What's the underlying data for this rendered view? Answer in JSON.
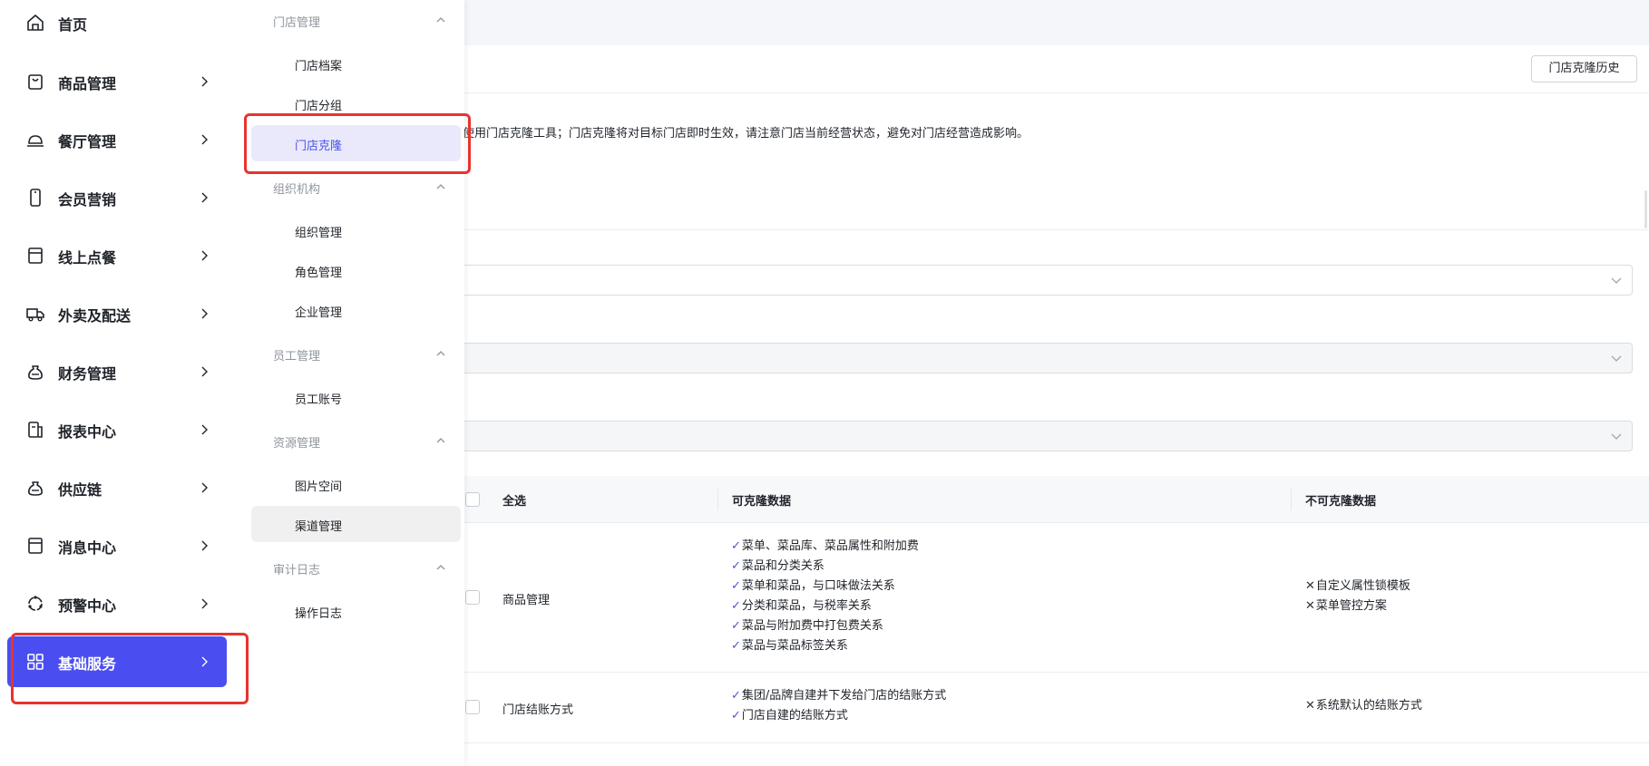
{
  "colors": {
    "accent": "#4a4ef0",
    "accent_text": "#4a51e8",
    "active_sub_bg": "#e9e9fb",
    "highlight": "#e8332f"
  },
  "nav": {
    "items": [
      {
        "label": "首页",
        "icon": "home-icon"
      },
      {
        "label": "商品管理",
        "icon": "shopping-bag-icon"
      },
      {
        "label": "餐厅管理",
        "icon": "dish-cover-icon"
      },
      {
        "label": "会员营销",
        "icon": "mobile-phone-icon"
      },
      {
        "label": "线上点餐",
        "icon": "storefront-icon"
      },
      {
        "label": "外卖及配送",
        "icon": "delivery-truck-icon"
      },
      {
        "label": "财务管理",
        "icon": "money-bag-icon"
      },
      {
        "label": "报表中心",
        "icon": "report-icon"
      },
      {
        "label": "供应链",
        "icon": "supply-chain-icon"
      },
      {
        "label": "消息中心",
        "icon": "message-box-icon"
      },
      {
        "label": "预警中心",
        "icon": "alert-icon"
      },
      {
        "label": "基础服务",
        "icon": "grid-icon",
        "active": true
      }
    ]
  },
  "subnav": {
    "groups": [
      {
        "title": "门店管理",
        "items": [
          "门店档案",
          "门店分组",
          "门店克隆"
        ]
      },
      {
        "title": "组织机构",
        "items": [
          "组织管理",
          "角色管理",
          "企业管理"
        ]
      },
      {
        "title": "员工管理",
        "items": [
          "员工账号"
        ]
      },
      {
        "title": "资源管理",
        "items": [
          "图片空间",
          "渠道管理"
        ]
      },
      {
        "title": "审计日志",
        "items": [
          "操作日志"
        ]
      }
    ],
    "active_item": "门店克隆",
    "hovered_item": "渠道管理"
  },
  "header": {
    "history_button": "门店克隆历史"
  },
  "notice": "使用门店克隆工具；门店克隆将对目标门店即时生效，请注意门店当前经营状态，避免对门店经营造成影响。",
  "table": {
    "columns": {
      "select_all": "全选",
      "clonable": "可克隆数据",
      "not_clonable": "不可克隆数据"
    },
    "rows": [
      {
        "name": "商品管理",
        "clonable": [
          "菜单、菜品库、菜品属性和附加费",
          "菜品和分类关系",
          "菜单和菜品，与口味做法关系",
          "分类和菜品，与税率关系",
          "菜品与附加费中打包费关系",
          "菜品与菜品标签关系"
        ],
        "not_clonable": [
          "自定义属性锁模板",
          "菜单管控方案"
        ]
      },
      {
        "name": "门店结账方式",
        "clonable": [
          "集团/品牌自建并下发给门店的结账方式",
          "门店自建的结账方式"
        ],
        "not_clonable": [
          "系统默认的结账方式"
        ]
      }
    ]
  },
  "symbols": {
    "check": "✓",
    "cross": "✕"
  }
}
